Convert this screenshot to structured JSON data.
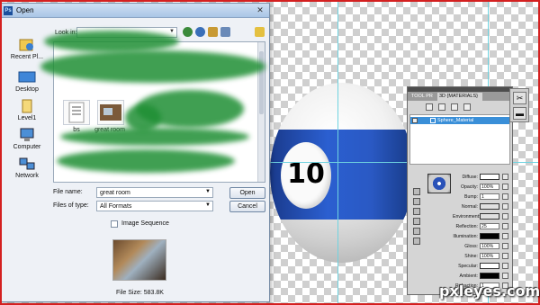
{
  "dialog": {
    "title": "Open",
    "close_glyph": "✕",
    "lookin_label": "Look in:",
    "places": [
      {
        "label": "Recent Pl...",
        "icon": "recent-places-icon"
      },
      {
        "label": "Desktop",
        "icon": "desktop-icon"
      },
      {
        "label": "Level1",
        "icon": "library-icon"
      },
      {
        "label": "Computer",
        "icon": "computer-icon"
      },
      {
        "label": "Network",
        "icon": "network-icon"
      }
    ],
    "files": [
      {
        "label": "bs",
        "icon": "document-thumbnail-icon"
      },
      {
        "label": "great room",
        "icon": "image-thumbnail-icon"
      }
    ],
    "file_name_label": "File name:",
    "file_name_value": "great room",
    "files_of_type_label": "Files of type:",
    "files_of_type_value": "All Formats",
    "open_button": "Open",
    "cancel_button": "Cancel",
    "image_sequence_label": "Image Sequence",
    "image_sequence_checked": false,
    "file_size": "File Size: 583.8K"
  },
  "ball": {
    "number": "10",
    "stripe_color": "#2b5fd0"
  },
  "panel": {
    "tabs": [
      "TOOL PR",
      "3D {MATERIALS}"
    ],
    "material_name": "Sphere_Material",
    "properties": [
      {
        "label": "Diffuse:",
        "kind": "swatch",
        "color": "#ffffff"
      },
      {
        "label": "Opacity:",
        "kind": "field",
        "value": "100%"
      },
      {
        "label": "Bump:",
        "kind": "field",
        "value": "1"
      },
      {
        "label": "Normal:",
        "kind": "swatch",
        "color": "#e0e0e0"
      },
      {
        "label": "Environment:",
        "kind": "swatch",
        "color": "#e0e0e0"
      },
      {
        "label": "Reflection:",
        "kind": "field",
        "value": "25"
      },
      {
        "label": "Illumination:",
        "kind": "swatch",
        "color": "#000000"
      },
      {
        "label": "Gloss:",
        "kind": "field",
        "value": "100%"
      },
      {
        "label": "Shine:",
        "kind": "field",
        "value": "100%"
      },
      {
        "label": "Specular:",
        "kind": "swatch",
        "color": "#ffffff"
      },
      {
        "label": "Ambient:",
        "kind": "swatch",
        "color": "#000000"
      },
      {
        "label": "Refraction:",
        "kind": "field",
        "value": "1"
      }
    ]
  },
  "watermark": "pxleyes.com",
  "colors": {
    "frame": "#d42020",
    "guides": "#6fd3e0",
    "material_selected": "#3a8fd8",
    "redaction": "#1f8f34"
  }
}
